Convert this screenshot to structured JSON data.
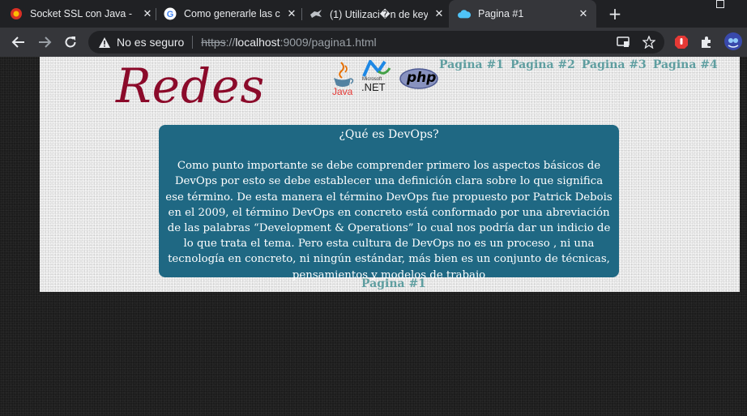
{
  "browser": {
    "tabs": [
      {
        "title": "Socket SSL con Java -",
        "favicon": "java-socket-favicon",
        "active": false
      },
      {
        "title": "Como generarle las cl",
        "favicon": "google-favicon",
        "active": false
      },
      {
        "title": "(1) Utilizaci�n de key",
        "favicon": "ninja-favicon",
        "active": false
      },
      {
        "title": "Pagina #1",
        "favicon": "cloud-favicon",
        "active": true
      }
    ],
    "new_tab_label": "+",
    "address_bar": {
      "security_label": "No es seguro",
      "url_scheme": "https",
      "url_separator": "://",
      "url_host": "localhost",
      "url_rest": ":9009/pagina1.html"
    }
  },
  "page": {
    "logo_text": "Redes",
    "tech_logos": [
      {
        "icon": "java-logo-icon",
        "label": "Java"
      },
      {
        "icon": "dotnet-logo-icon",
        "top_label": "Microsoft",
        "label": ".NET"
      },
      {
        "icon": "php-logo-icon",
        "label": "php"
      }
    ],
    "nav": [
      "Pagina #1",
      "Pagina #2",
      "Pagina #3",
      "Pagina #4"
    ],
    "content": {
      "heading": "¿Qué es DevOps?",
      "body": "Como punto importante se debe comprender primero los aspectos básicos de DevOps por esto se debe establecer una definición clara sobre lo que significa ese término. De esta manera el término DevOps fue propuesto por Patrick Debois en el 2009, el término DevOps en concreto está conformado por una abreviación de las palabras “Development & Operations” lo cual nos podría dar un indicio de lo que trata el tema. Pero esta cultura de DevOps no es un proceso , ni una tecnología en concreto, ni ningún estándar, más bien es un conjunto de técnicas, pensamientos y modelos de trabajo"
    },
    "footer_link": "Pagina #1"
  },
  "colors": {
    "content_box": "#1f6883",
    "nav_link": "#5f9ea0",
    "logo": "#8b0a2a"
  }
}
